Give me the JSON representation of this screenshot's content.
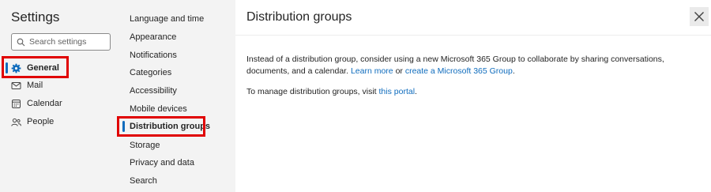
{
  "settings": {
    "title": "Settings",
    "search_placeholder": "Search settings"
  },
  "categories": [
    {
      "label": "General",
      "icon": "gear-icon",
      "selected": true
    },
    {
      "label": "Mail",
      "icon": "mail-icon",
      "selected": false
    },
    {
      "label": "Calendar",
      "icon": "calendar-icon",
      "selected": false
    },
    {
      "label": "People",
      "icon": "people-icon",
      "selected": false
    }
  ],
  "subcategories": [
    {
      "label": "Language and time",
      "selected": false
    },
    {
      "label": "Appearance",
      "selected": false
    },
    {
      "label": "Notifications",
      "selected": false
    },
    {
      "label": "Categories",
      "selected": false
    },
    {
      "label": "Accessibility",
      "selected": false
    },
    {
      "label": "Mobile devices",
      "selected": false
    },
    {
      "label": "Distribution groups",
      "selected": true
    },
    {
      "label": "Storage",
      "selected": false
    },
    {
      "label": "Privacy and data",
      "selected": false
    },
    {
      "label": "Search",
      "selected": false
    }
  ],
  "page": {
    "title": "Distribution groups",
    "para1": {
      "text": "Instead of a distribution group, consider using a new Microsoft 365 Group to collaborate by sharing conversations, documents, and a calendar.",
      "link1": "Learn more",
      "middle": "or",
      "link2": "create a Microsoft 365 Group",
      "end": "."
    },
    "para2": {
      "text": "To manage distribution groups, visit",
      "link": "this portal",
      "end": "."
    }
  },
  "colors": {
    "accent": "#0f6cbd",
    "highlight_box": "#e00000",
    "nav_bg": "#f3f3f3"
  }
}
